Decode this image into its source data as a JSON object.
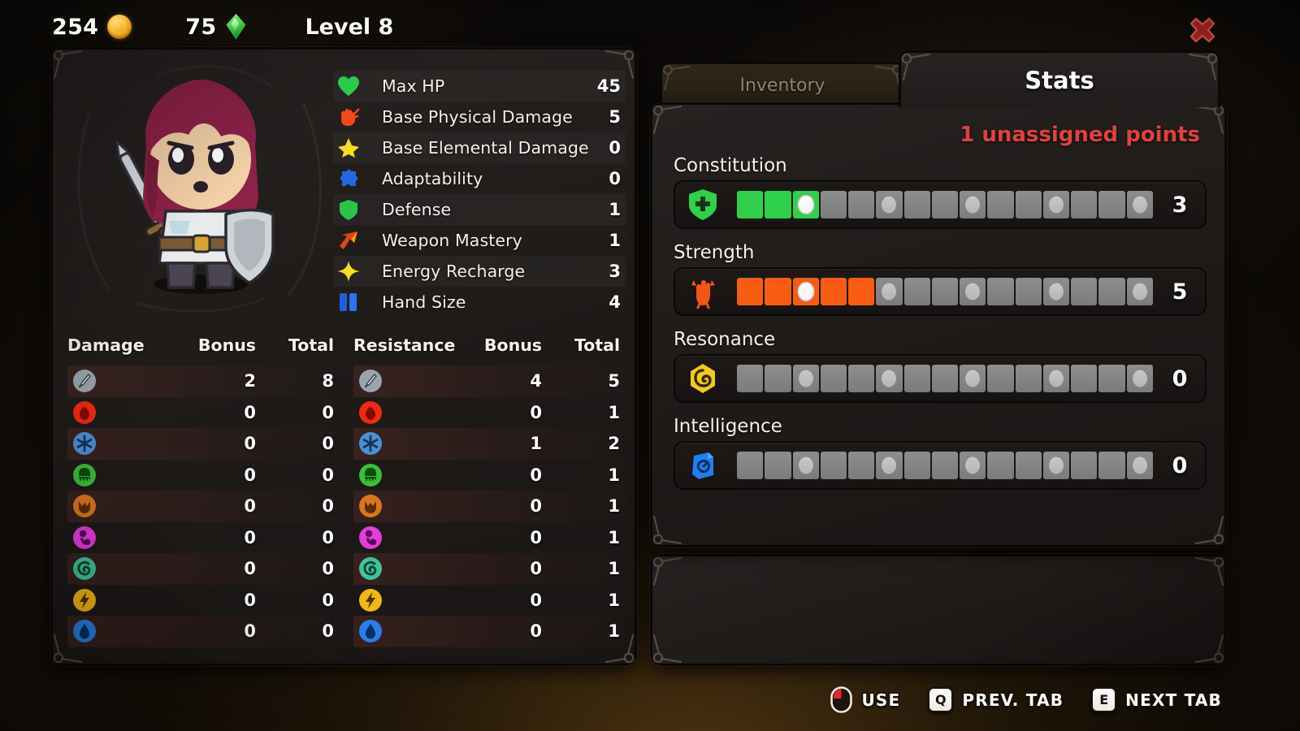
{
  "topbar": {
    "gold": "254",
    "gold_icon": "coin-icon",
    "gems": "75",
    "gem_icon": "gem-icon",
    "level": "Level 8",
    "close_icon": "close-x-icon"
  },
  "character": {
    "portrait_name": "knight-character-portrait"
  },
  "stats": {
    "rows": [
      {
        "icon": "heart-icon",
        "label": "Max HP",
        "value": "45"
      },
      {
        "icon": "fist-icon",
        "label": "Base Physical Damage",
        "value": "5"
      },
      {
        "icon": "burst-icon",
        "label": "Base Elemental Damage",
        "value": "0"
      },
      {
        "icon": "puzzle-icon",
        "label": "Adaptability",
        "value": "0"
      },
      {
        "icon": "shield-icon",
        "label": "Defense",
        "value": "1"
      },
      {
        "icon": "arrow-icon",
        "label": "Weapon Mastery",
        "value": "1"
      },
      {
        "icon": "sparkle-icon",
        "label": "Energy Recharge",
        "value": "3"
      },
      {
        "icon": "cards-icon",
        "label": "Hand Size",
        "value": "4"
      }
    ]
  },
  "damage_table": {
    "headers": {
      "name": "Damage",
      "bonus": "Bonus",
      "total": "Total"
    },
    "rows": [
      {
        "icon": "physical-sword-icon",
        "bonus": "2",
        "total": "8"
      },
      {
        "icon": "fire-icon",
        "bonus": "0",
        "total": "0"
      },
      {
        "icon": "ice-icon",
        "bonus": "0",
        "total": "0"
      },
      {
        "icon": "poison-icon",
        "bonus": "0",
        "total": "0"
      },
      {
        "icon": "earth-icon",
        "bonus": "0",
        "total": "0"
      },
      {
        "icon": "arcane-icon",
        "bonus": "0",
        "total": "0"
      },
      {
        "icon": "wind-icon",
        "bonus": "0",
        "total": "0"
      },
      {
        "icon": "lightning-icon",
        "bonus": "0",
        "total": "0"
      },
      {
        "icon": "water-icon",
        "bonus": "0",
        "total": "0"
      }
    ]
  },
  "resistance_table": {
    "headers": {
      "name": "Resistance",
      "bonus": "Bonus",
      "total": "Total"
    },
    "rows": [
      {
        "icon": "physical-sword-icon",
        "bonus": "4",
        "total": "5"
      },
      {
        "icon": "fire-icon",
        "bonus": "0",
        "total": "1"
      },
      {
        "icon": "ice-icon",
        "bonus": "1",
        "total": "2"
      },
      {
        "icon": "poison-icon",
        "bonus": "0",
        "total": "1"
      },
      {
        "icon": "earth-icon",
        "bonus": "0",
        "total": "1"
      },
      {
        "icon": "arcane-icon",
        "bonus": "0",
        "total": "1"
      },
      {
        "icon": "wind-icon",
        "bonus": "0",
        "total": "1"
      },
      {
        "icon": "lightning-icon",
        "bonus": "0",
        "total": "1"
      },
      {
        "icon": "water-icon",
        "bonus": "0",
        "total": "1"
      }
    ]
  },
  "tabs": [
    {
      "label": "Inventory",
      "active": false
    },
    {
      "label": "Stats",
      "active": true
    }
  ],
  "stats_panel": {
    "unassigned_text": "1 unassigned points",
    "unassigned_color": "#e0413f",
    "pip_total": 15,
    "milestone_every": 3,
    "attributes": [
      {
        "name": "Constitution",
        "icon": "shield-plus-icon",
        "value": "3",
        "filled": 3,
        "color": "#2fd14a"
      },
      {
        "name": "Strength",
        "icon": "fist-up-icon",
        "value": "5",
        "filled": 5,
        "color": "#f75c11"
      },
      {
        "name": "Resonance",
        "icon": "spiral-icon",
        "value": "0",
        "filled": 0,
        "color": "#f2cc15"
      },
      {
        "name": "Intelligence",
        "icon": "book-icon",
        "value": "0",
        "filled": 0,
        "color": "#1f7ff0"
      }
    ]
  },
  "hints": [
    {
      "key": "mouse-left-icon",
      "key_type": "mouse",
      "label": "USE"
    },
    {
      "key": "Q",
      "key_type": "key",
      "label": "PREV. TAB"
    },
    {
      "key": "E",
      "key_type": "key",
      "label": "NEXT TAB"
    }
  ]
}
